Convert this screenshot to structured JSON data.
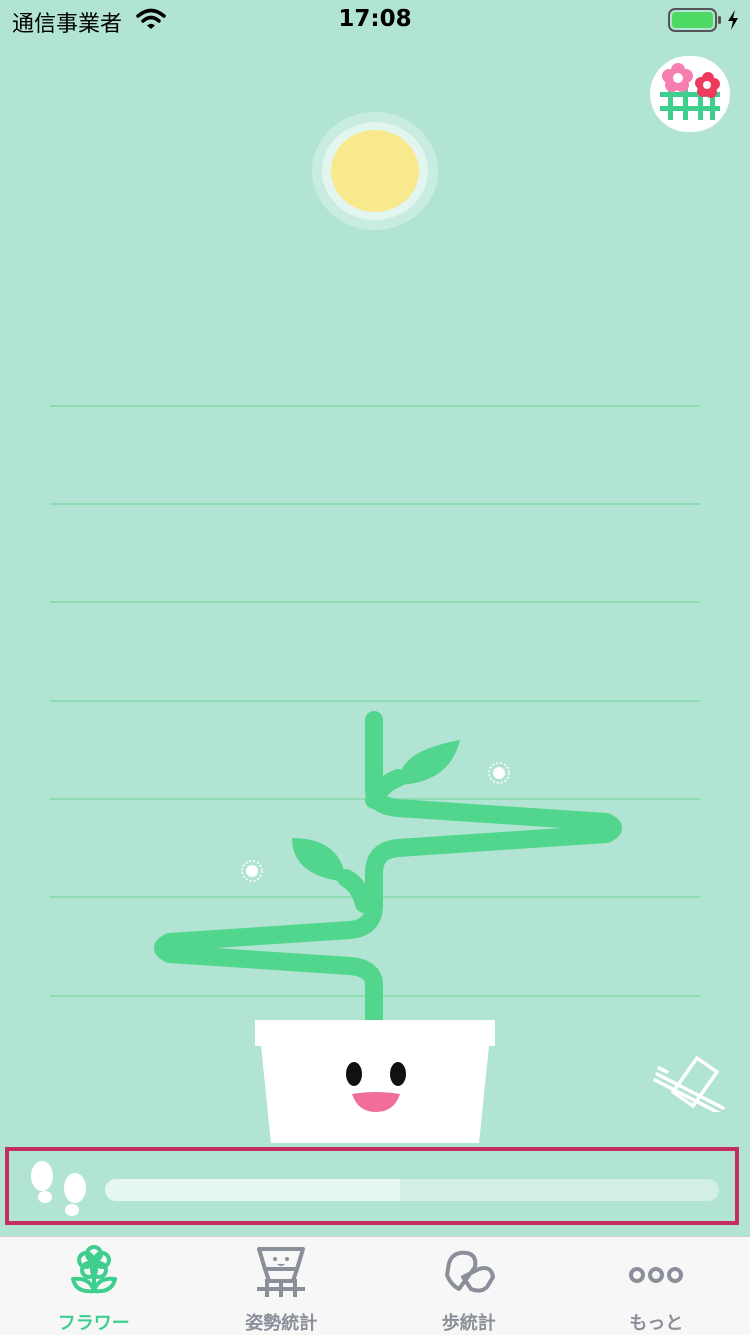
{
  "status": {
    "carrier": "通信事業者",
    "time": "17:08"
  },
  "steps": {
    "progress": 0.48
  },
  "tabs": [
    {
      "label": "フラワー",
      "icon": "flower-icon",
      "active": true
    },
    {
      "label": "姿勢統計",
      "icon": "posture-stats-icon",
      "active": false
    },
    {
      "label": "歩統計",
      "icon": "step-stats-icon",
      "active": false
    },
    {
      "label": "もっと",
      "icon": "more-icon",
      "active": false
    }
  ],
  "colors": {
    "background": "#b2e4d3",
    "accent": "#3ecf8e",
    "stem": "#52d68e",
    "sun": "#f8e98c",
    "highlight_border": "#c42d63"
  }
}
